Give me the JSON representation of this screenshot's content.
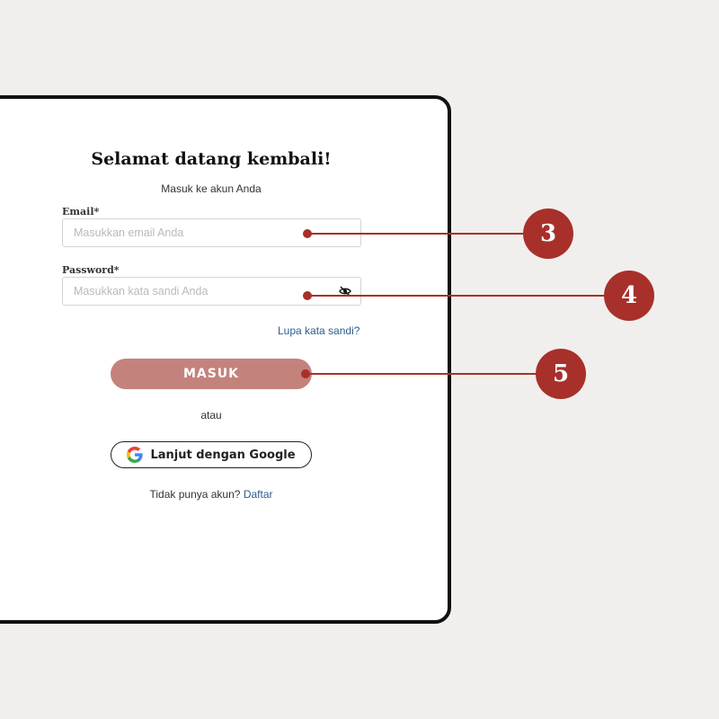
{
  "login": {
    "title": "Selamat datang kembali!",
    "subtitle": "Masuk ke akun Anda",
    "email_label": "Email*",
    "email_placeholder": "Masukkan email Anda",
    "password_label": "Password*",
    "password_placeholder": "Masukkan kata sandi Anda",
    "forgot_link": "Lupa kata sandi?",
    "submit_label": "MASUK",
    "divider": "atau",
    "google_label": "Lanjut dengan Google",
    "signup_prompt": "Tidak punya akun?",
    "signup_link": "Daftar"
  },
  "annotations": [
    {
      "number": "3",
      "target": "email-field"
    },
    {
      "number": "4",
      "target": "password-field"
    },
    {
      "number": "5",
      "target": "masuk-button"
    }
  ],
  "colors": {
    "accent": "#a8302a",
    "button": "#c4827c",
    "link": "#2c5d8f",
    "background": "#f0efed"
  },
  "icons": {
    "password_toggle": "eye-slash-icon",
    "google": "google-logo-icon"
  }
}
